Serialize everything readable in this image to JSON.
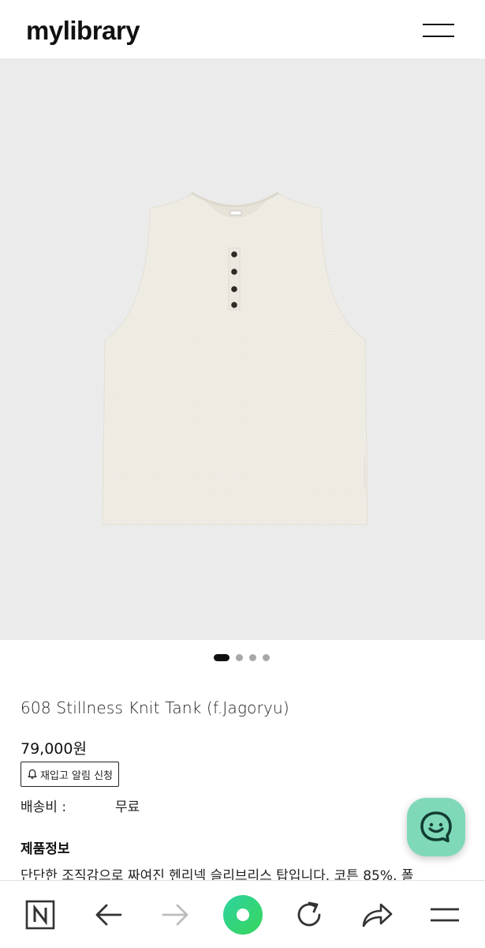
{
  "header": {
    "logo_text": "mylibrary",
    "menu_icon": "hamburger-menu-icon"
  },
  "gallery": {
    "image_subject": "sleeveless henley knit tank top, ivory",
    "slide_count": 4,
    "active_slide": 1
  },
  "product": {
    "title": "608 Stillness Knit Tank (f.Jagoryu)",
    "price": "79,000원",
    "restock_button_label": "재입고 알림 신청",
    "restock_icon": "bell-icon",
    "shipping_label": "배송비 :",
    "shipping_value": "무료",
    "info_title": "제품정보",
    "info_text": "단단한 조직감으로 짜여진 헨리넥 슬리브리스 탑입니다. 코튼 85%, 폴"
  },
  "chat": {
    "icon": "chat-bubble-icon",
    "color": "#7fd9b8"
  },
  "browser_toolbar": {
    "items": [
      "naver-home-icon",
      "back-arrow-icon",
      "forward-arrow-icon",
      "green-dot-icon",
      "reload-icon",
      "share-icon",
      "menu-icon"
    ],
    "accent_color": "#2ed47a"
  }
}
